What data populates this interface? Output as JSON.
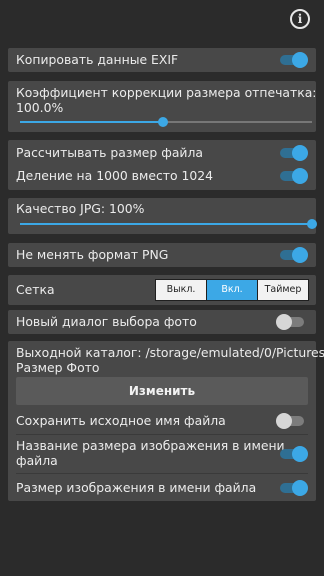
{
  "toolbar": {
    "info_icon": "info-icon",
    "info_glyph": "i"
  },
  "settings": {
    "copy_exif": {
      "label": "Копировать данные EXIF",
      "on": true
    },
    "print_correction": {
      "label_line1": "Коэффициент коррекции размера отпечатка:",
      "label_line2": "100.0%",
      "slider_value_fraction": 0.49
    },
    "calc_file_size": {
      "label": "Рассчитывать размер файла",
      "on": true
    },
    "divide_1000": {
      "label": "Деление на 1000 вместо 1024",
      "on": true
    },
    "jpg_quality": {
      "label": "Качество JPG: 100%",
      "slider_value_fraction": 1.0
    },
    "keep_png": {
      "label": "Не менять формат PNG",
      "on": true
    },
    "grid": {
      "label": "Сетка",
      "options": [
        "Выкл.",
        "Вкл.",
        "Таймер"
      ],
      "selected": "Вкл."
    },
    "new_photo_dialog": {
      "label": "Новый диалог выбора фото",
      "on": false
    },
    "output_dir": {
      "label_line1": "Выходной каталог: /storage/emulated/0/Pictures/",
      "label_line2": "Размер Фото",
      "button_label": "Изменить"
    },
    "keep_original_name": {
      "label": "Сохранить исходное имя файла",
      "on": false
    },
    "size_name_in_filename": {
      "label_line1": "Название размера изображения в имени",
      "label_line2": "файла",
      "on": true
    },
    "size_in_filename": {
      "label": "Размер изображения в имени файла",
      "on": true
    }
  },
  "colors": {
    "accent": "#3ca8e6",
    "card": "#484848",
    "background": "#2b2b2b"
  }
}
